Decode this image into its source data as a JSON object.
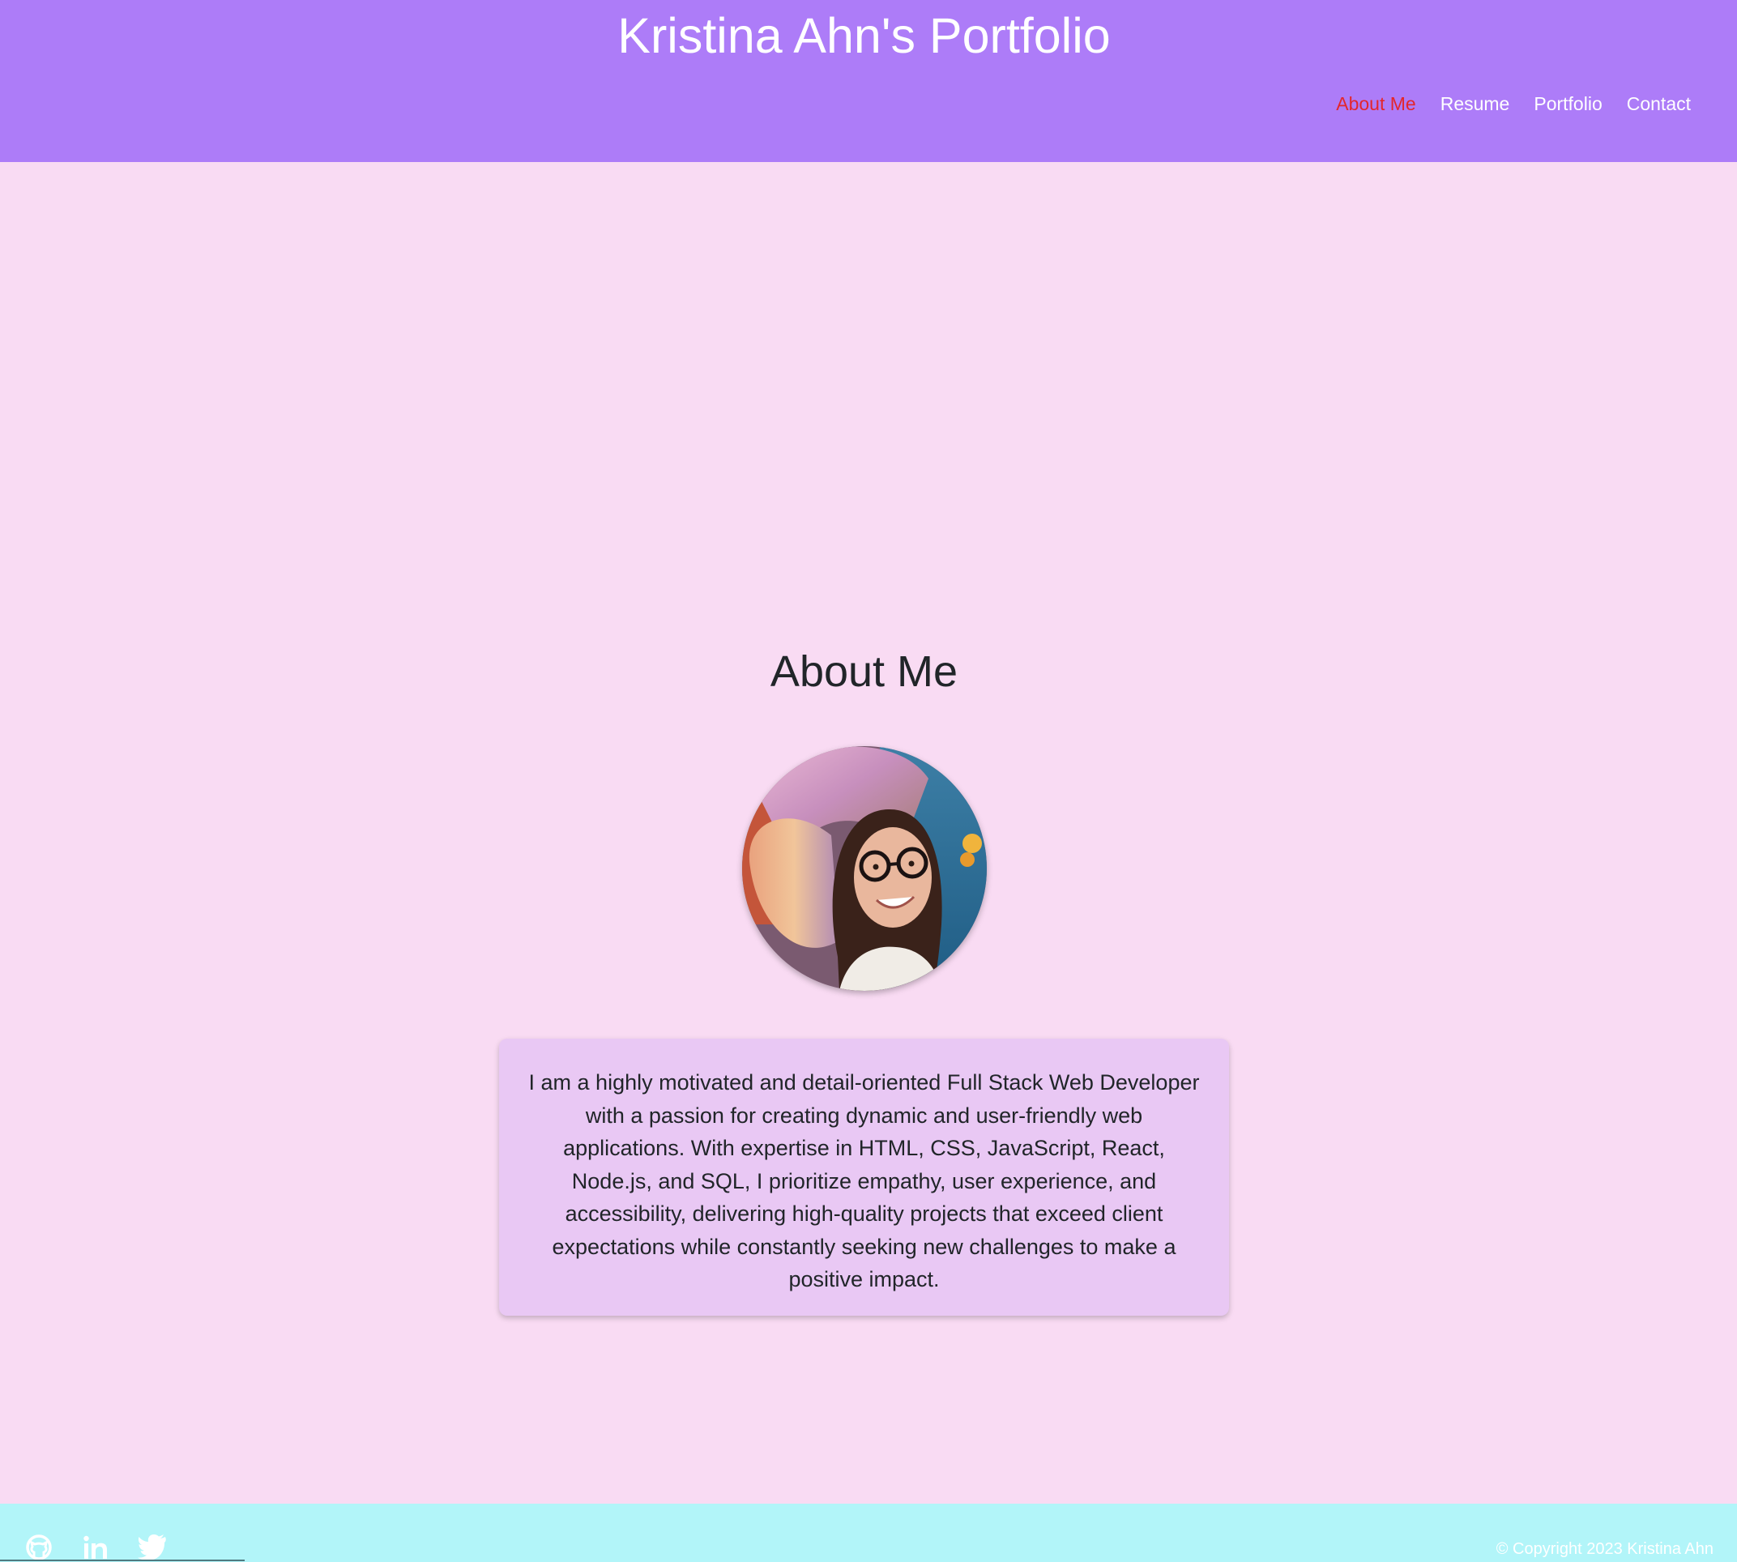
{
  "header": {
    "title": "Kristina Ahn's Portfolio",
    "nav": [
      {
        "label": "About Me",
        "active": true
      },
      {
        "label": "Resume",
        "active": false
      },
      {
        "label": "Portfolio",
        "active": false
      },
      {
        "label": "Contact",
        "active": false
      }
    ]
  },
  "about": {
    "heading": "About Me",
    "bio": "I am a highly motivated and detail-oriented Full Stack Web Developer with a passion for creating dynamic and user-friendly web applications. With expertise in HTML, CSS, JavaScript, React, Node.js, and SQL, I prioritize empathy, user experience, and accessibility, delivering high-quality projects that exceed client expectations while constantly seeking new challenges to make a positive impact."
  },
  "footer": {
    "social": [
      {
        "icon": "github-icon"
      },
      {
        "icon": "linkedin-icon"
      },
      {
        "icon": "twitter-icon"
      }
    ],
    "copyright": "© Copyright 2023 Kristina Ahn"
  },
  "colors": {
    "header_bg": "#ad7cf8",
    "page_bg": "#f9dbf3",
    "card_bg": "#e9c8f4",
    "footer_bg": "#b2f5f9",
    "nav_active": "#e3262c"
  }
}
